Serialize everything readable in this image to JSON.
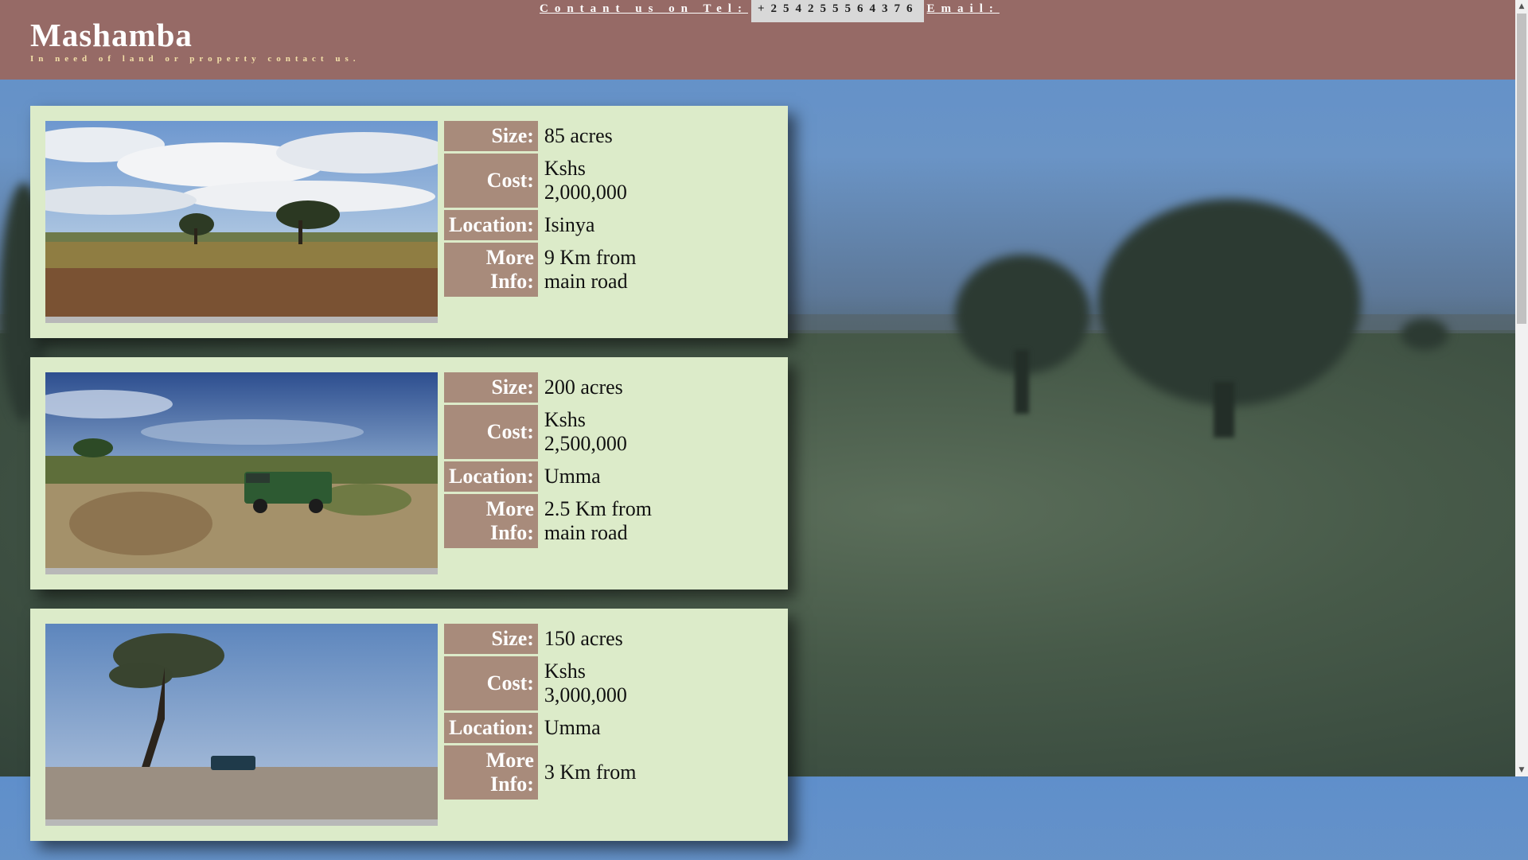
{
  "header": {
    "contact_label": "Contant us on Tel:",
    "phone": "+254255564376",
    "email_label": "Email:",
    "title": "Mashamba",
    "tagline": "In need of land or property contact us."
  },
  "labels": {
    "size": "Size:",
    "cost": "Cost:",
    "location": "Location:",
    "more_info": "More Info:"
  },
  "listings": [
    {
      "size": "85 acres",
      "cost": "Kshs 2,000,000",
      "location": "Isinya",
      "more_info": "9 Km from main road",
      "photo": "savanna-clouds-acacia"
    },
    {
      "size": "200 acres",
      "cost": "Kshs 2,500,000",
      "location": "Umma",
      "more_info": "2.5 Km from main road",
      "photo": "river-safari-vehicle"
    },
    {
      "size": "150 acres",
      "cost": "Kshs 3,000,000",
      "location": "Umma",
      "more_info": "3 Km from",
      "photo": "lone-acacia-vehicle"
    }
  ],
  "colors": {
    "header_bg": "#966a66",
    "card_bg": "#dcebc9",
    "label_bg": "#a88b7b",
    "tagline": "#f3e0a8"
  }
}
